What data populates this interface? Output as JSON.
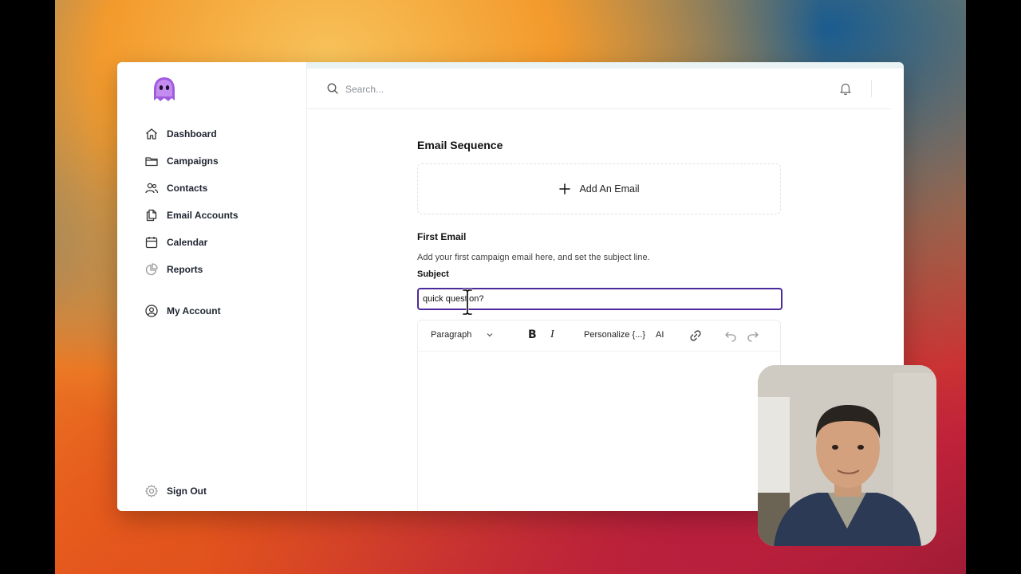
{
  "search": {
    "placeholder": "Search..."
  },
  "sidebar": {
    "items": [
      {
        "label": "Dashboard",
        "icon": "home-icon"
      },
      {
        "label": "Campaigns",
        "icon": "folder-icon"
      },
      {
        "label": "Contacts",
        "icon": "users-icon"
      },
      {
        "label": "Email Accounts",
        "icon": "documents-icon"
      },
      {
        "label": "Calendar",
        "icon": "calendar-icon"
      },
      {
        "label": "Reports",
        "icon": "pie-chart-icon"
      },
      {
        "label": "My Account",
        "icon": "user-circle-icon"
      }
    ],
    "sign_out": "Sign Out"
  },
  "main": {
    "section_title": "Email Sequence",
    "add_email_label": "Add An Email",
    "first_email": {
      "title": "First Email",
      "description": "Add your first campaign email here, and set the subject line.",
      "subject_label": "Subject",
      "subject_value": "quick question?"
    },
    "editor": {
      "format_select": "Paragraph",
      "bold": "B",
      "italic": "I",
      "personalize": "Personalize {...}",
      "ai": "AI"
    }
  },
  "colors": {
    "accent": "#4b2a9a",
    "logo": "#9a4dd8"
  }
}
